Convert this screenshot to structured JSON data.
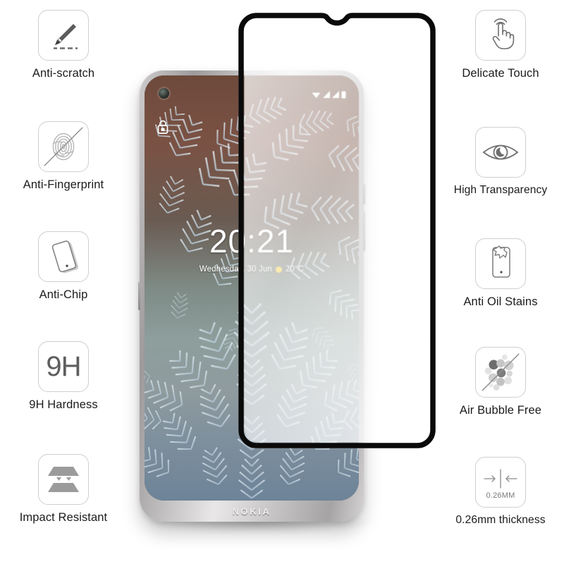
{
  "product": {
    "brand": "NOKIA",
    "type": "Tempered Glass Screen Protector Infographic"
  },
  "features_left": [
    {
      "label": "Anti-scratch",
      "icon": "knife-scratch-icon"
    },
    {
      "label": "Anti-Fingerprint",
      "icon": "fingerprint-crossed-icon"
    },
    {
      "label": "Anti-Chip",
      "icon": "tilted-phone-icon"
    },
    {
      "label": "9H Hardness",
      "icon": "hardness-9h-icon",
      "badge_text": "9H"
    },
    {
      "label": "Impact Resistant",
      "icon": "impact-layers-icon"
    }
  ],
  "features_right": [
    {
      "label": "Delicate Touch",
      "icon": "touch-hand-icon"
    },
    {
      "label": "High Transparency",
      "icon": "eye-icon"
    },
    {
      "label": "Anti Oil Stains",
      "icon": "phone-oil-stain-icon"
    },
    {
      "label": "Air Bubble Free",
      "icon": "bubbles-crossed-icon"
    },
    {
      "label": "0.26mm thickness",
      "icon": "thickness-arrows-icon",
      "badge_text": "0.26MM"
    }
  ],
  "phone_screen": {
    "time": "20:21",
    "date": "Wednesday, 30 Jun",
    "temperature": "20°C",
    "weather_icon": "sun-icon",
    "lock_icon": "lock-icon",
    "status_icons": [
      "wifi-icon",
      "signal-icon",
      "signal-icon",
      "battery-icon"
    ],
    "wallpaper": "frost-ice-crystals"
  },
  "colors": {
    "badge_border": "#cfcfcf",
    "label_text": "#1b1b1b",
    "icon_gray": "#6b6b6b",
    "icon_light_gray": "#b9b9b9",
    "glass_frame": "#0a0a0a",
    "sun_yellow": "#f6cf3f",
    "background": "#ffffff"
  }
}
